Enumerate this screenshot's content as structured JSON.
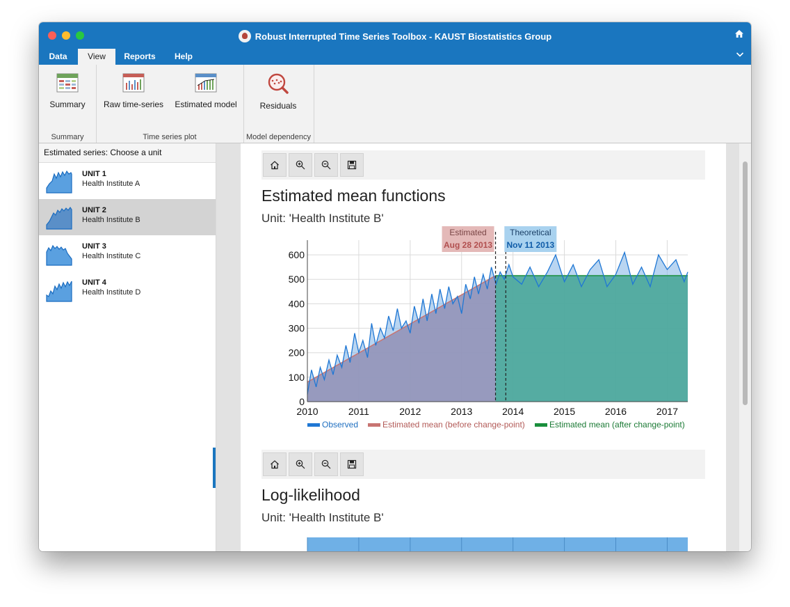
{
  "window": {
    "title": "Robust Interrupted Time Series Toolbox - KAUST Biostatistics Group"
  },
  "menu_tabs": [
    {
      "label": "Data"
    },
    {
      "label": "View",
      "active": true
    },
    {
      "label": "Reports"
    },
    {
      "label": "Help"
    }
  ],
  "ribbon": {
    "groups": [
      {
        "label": "Summary",
        "buttons": [
          {
            "label": "Summary",
            "icon": "summary-table-icon"
          }
        ]
      },
      {
        "label": "Time series plot",
        "buttons": [
          {
            "label": "Raw time-series",
            "icon": "raw-series-chart-icon"
          },
          {
            "label": "Estimated model",
            "icon": "estimated-model-chart-icon"
          }
        ]
      },
      {
        "label": "Model dependency",
        "buttons": [
          {
            "label": "Residuals",
            "icon": "residuals-magnifier-icon"
          }
        ]
      }
    ]
  },
  "left_panel": {
    "header": "Estimated series: Choose a unit",
    "units": [
      {
        "name": "UNIT 1",
        "institute": "Health Institute A",
        "selected": false
      },
      {
        "name": "UNIT 2",
        "institute": "Health Institute B",
        "selected": true
      },
      {
        "name": "UNIT 3",
        "institute": "Health Institute C",
        "selected": false
      },
      {
        "name": "UNIT 4",
        "institute": "Health Institute D",
        "selected": false
      }
    ]
  },
  "plot_toolbar_icons": [
    "home-icon",
    "zoom-in-icon",
    "zoom-out-icon",
    "save-icon"
  ],
  "plot1": {
    "title": "Estimated mean functions",
    "subtitle": "Unit: 'Health Institute B'"
  },
  "plot2": {
    "title": "Log-likelihood",
    "subtitle": "Unit: 'Health Institute B'"
  },
  "colors": {
    "accent": "#1a76bf",
    "observed": "#1f77d4",
    "before_mean": "#c87471",
    "after_mean": "#1a8f3c",
    "before_fill": "#9494b8",
    "after_fill": "#4ca89b"
  },
  "chart_data": [
    {
      "type": "line",
      "title": "Estimated mean functions",
      "subtitle": "Unit: 'Health Institute B'",
      "x_ticks": [
        "2010",
        "2011",
        "2012",
        "2013",
        "2014",
        "2015",
        "2016",
        "2017"
      ],
      "y_ticks": [
        0,
        100,
        200,
        300,
        400,
        500,
        600
      ],
      "xlim": [
        2010.0,
        2017.4
      ],
      "ylim": [
        0,
        660
      ],
      "grid": true,
      "legend_position": "bottom",
      "series": [
        {
          "name": "Observed",
          "x": [
            2010.0,
            2010.08,
            2010.17,
            2010.25,
            2010.33,
            2010.42,
            2010.5,
            2010.58,
            2010.67,
            2010.75,
            2010.83,
            2010.92,
            2011.0,
            2011.08,
            2011.17,
            2011.25,
            2011.33,
            2011.42,
            2011.5,
            2011.58,
            2011.67,
            2011.75,
            2011.83,
            2011.92,
            2012.0,
            2012.08,
            2012.17,
            2012.25,
            2012.33,
            2012.42,
            2012.5,
            2012.58,
            2012.67,
            2012.75,
            2012.83,
            2012.92,
            2013.0,
            2013.08,
            2013.17,
            2013.25,
            2013.33,
            2013.42,
            2013.5,
            2013.58,
            2013.67,
            2013.75,
            2013.83,
            2013.92,
            2014.0,
            2014.17,
            2014.33,
            2014.5,
            2014.67,
            2014.83,
            2015.0,
            2015.17,
            2015.33,
            2015.5,
            2015.67,
            2015.83,
            2016.0,
            2016.17,
            2016.33,
            2016.5,
            2016.67,
            2016.83,
            2017.0,
            2017.17,
            2017.33,
            2017.4
          ],
          "y": [
            30,
            130,
            60,
            140,
            90,
            170,
            110,
            190,
            140,
            230,
            160,
            280,
            200,
            250,
            180,
            320,
            230,
            300,
            260,
            350,
            290,
            380,
            300,
            330,
            280,
            390,
            320,
            420,
            330,
            440,
            360,
            460,
            380,
            470,
            400,
            430,
            360,
            480,
            420,
            510,
            440,
            520,
            460,
            550,
            480,
            530,
            500,
            560,
            510,
            480,
            550,
            470,
            530,
            600,
            490,
            560,
            470,
            540,
            580,
            470,
            520,
            610,
            480,
            550,
            470,
            600,
            540,
            580,
            490,
            530
          ]
        },
        {
          "name": "Estimated mean (before change-point)",
          "x": [
            2010.0,
            2013.66
          ],
          "y": [
            80,
            515
          ]
        },
        {
          "name": "Estimated mean (after change-point)",
          "x": [
            2013.66,
            2017.4
          ],
          "y": [
            515,
            515
          ]
        }
      ],
      "change_points": [
        {
          "label": "Estimated",
          "date": "Aug 28 2013",
          "x": 2013.66
        },
        {
          "label": "Theoretical",
          "date": "Nov 11 2013",
          "x": 2013.86
        }
      ]
    },
    {
      "type": "line",
      "title": "Log-likelihood",
      "subtitle": "Unit: 'Health Institute B'",
      "series": []
    }
  ]
}
